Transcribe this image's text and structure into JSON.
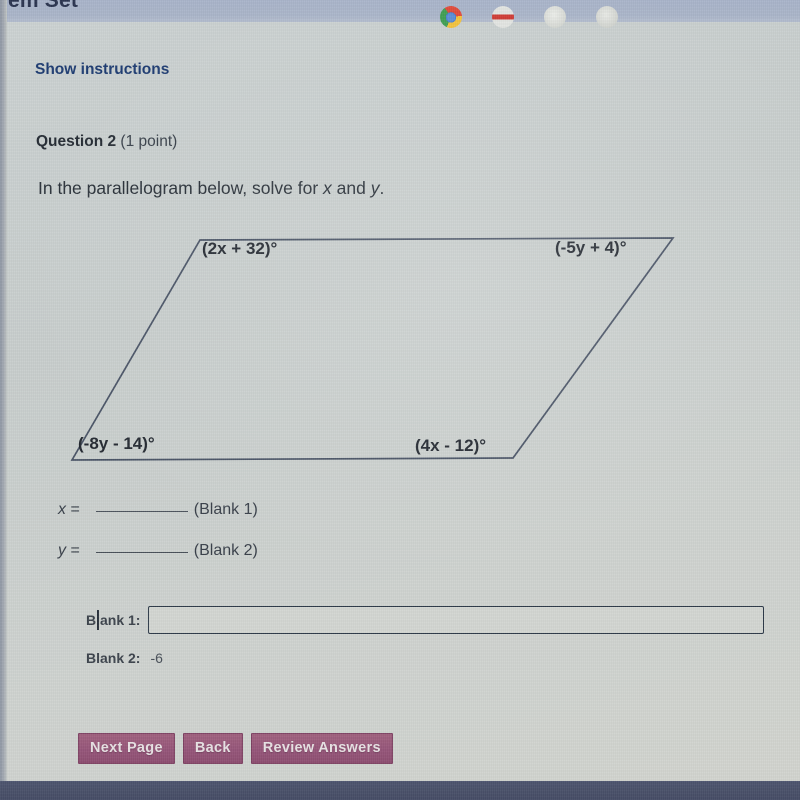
{
  "app": {
    "banner_title": "em Set",
    "taskbar_icons": [
      "chrome-icon",
      "app-icon-red",
      "app-icon-pale",
      "app-icon-pale-2"
    ]
  },
  "toolbar": {
    "show_instructions": "Show instructions"
  },
  "question": {
    "label": "Question 2",
    "points": "(1 point)",
    "prompt_before": "In the parallelogram below, solve for ",
    "prompt_var1": "x",
    "prompt_middle": " and ",
    "prompt_var2": "y",
    "prompt_after": "."
  },
  "figure": {
    "name": "parallelogram",
    "stroke_color": "#4a5466",
    "angles": {
      "top_left": "(2x + 32)°",
      "top_right": "(-5y + 4)°",
      "bottom_left": "(-8y - 14)°",
      "bottom_right": "(4x - 12)°"
    }
  },
  "blanks": {
    "x_var": "x",
    "x_equals": "=",
    "x_caption": "(Blank 1)",
    "y_var": "y",
    "y_equals": "=",
    "y_caption": "(Blank 2)"
  },
  "answers": {
    "blank1_label": "Blank 1:",
    "blank1_value": "",
    "blank1_placeholder": "",
    "blank2_label": "Blank 2:",
    "blank2_value": "-6"
  },
  "buttons": {
    "next_page": "Next Page",
    "back": "Back",
    "review_answers": "Review Answers"
  },
  "colors": {
    "link": "#1f3d73",
    "button": "#96567a",
    "page_bg": "#ccd2d2",
    "taskbar": "#4a5169"
  }
}
